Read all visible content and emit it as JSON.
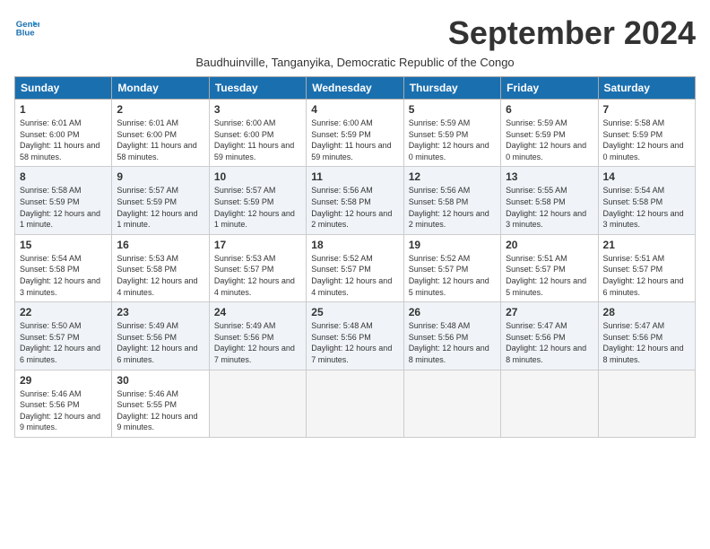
{
  "header": {
    "logo_line1": "General",
    "logo_line2": "Blue",
    "title": "September 2024",
    "subtitle": "Baudhuinville, Tanganyika, Democratic Republic of the Congo"
  },
  "days_of_week": [
    "Sunday",
    "Monday",
    "Tuesday",
    "Wednesday",
    "Thursday",
    "Friday",
    "Saturday"
  ],
  "weeks": [
    [
      {
        "day": "1",
        "rise": "6:01 AM",
        "set": "6:00 PM",
        "daylight": "11 hours and 58 minutes."
      },
      {
        "day": "2",
        "rise": "6:01 AM",
        "set": "6:00 PM",
        "daylight": "11 hours and 58 minutes."
      },
      {
        "day": "3",
        "rise": "6:00 AM",
        "set": "6:00 PM",
        "daylight": "11 hours and 59 minutes."
      },
      {
        "day": "4",
        "rise": "6:00 AM",
        "set": "5:59 PM",
        "daylight": "11 hours and 59 minutes."
      },
      {
        "day": "5",
        "rise": "5:59 AM",
        "set": "5:59 PM",
        "daylight": "12 hours and 0 minutes."
      },
      {
        "day": "6",
        "rise": "5:59 AM",
        "set": "5:59 PM",
        "daylight": "12 hours and 0 minutes."
      },
      {
        "day": "7",
        "rise": "5:58 AM",
        "set": "5:59 PM",
        "daylight": "12 hours and 0 minutes."
      }
    ],
    [
      {
        "day": "8",
        "rise": "5:58 AM",
        "set": "5:59 PM",
        "daylight": "12 hours and 1 minute."
      },
      {
        "day": "9",
        "rise": "5:57 AM",
        "set": "5:59 PM",
        "daylight": "12 hours and 1 minute."
      },
      {
        "day": "10",
        "rise": "5:57 AM",
        "set": "5:59 PM",
        "daylight": "12 hours and 1 minute."
      },
      {
        "day": "11",
        "rise": "5:56 AM",
        "set": "5:58 PM",
        "daylight": "12 hours and 2 minutes."
      },
      {
        "day": "12",
        "rise": "5:56 AM",
        "set": "5:58 PM",
        "daylight": "12 hours and 2 minutes."
      },
      {
        "day": "13",
        "rise": "5:55 AM",
        "set": "5:58 PM",
        "daylight": "12 hours and 3 minutes."
      },
      {
        "day": "14",
        "rise": "5:54 AM",
        "set": "5:58 PM",
        "daylight": "12 hours and 3 minutes."
      }
    ],
    [
      {
        "day": "15",
        "rise": "5:54 AM",
        "set": "5:58 PM",
        "daylight": "12 hours and 3 minutes."
      },
      {
        "day": "16",
        "rise": "5:53 AM",
        "set": "5:58 PM",
        "daylight": "12 hours and 4 minutes."
      },
      {
        "day": "17",
        "rise": "5:53 AM",
        "set": "5:57 PM",
        "daylight": "12 hours and 4 minutes."
      },
      {
        "day": "18",
        "rise": "5:52 AM",
        "set": "5:57 PM",
        "daylight": "12 hours and 4 minutes."
      },
      {
        "day": "19",
        "rise": "5:52 AM",
        "set": "5:57 PM",
        "daylight": "12 hours and 5 minutes."
      },
      {
        "day": "20",
        "rise": "5:51 AM",
        "set": "5:57 PM",
        "daylight": "12 hours and 5 minutes."
      },
      {
        "day": "21",
        "rise": "5:51 AM",
        "set": "5:57 PM",
        "daylight": "12 hours and 6 minutes."
      }
    ],
    [
      {
        "day": "22",
        "rise": "5:50 AM",
        "set": "5:57 PM",
        "daylight": "12 hours and 6 minutes."
      },
      {
        "day": "23",
        "rise": "5:49 AM",
        "set": "5:56 PM",
        "daylight": "12 hours and 6 minutes."
      },
      {
        "day": "24",
        "rise": "5:49 AM",
        "set": "5:56 PM",
        "daylight": "12 hours and 7 minutes."
      },
      {
        "day": "25",
        "rise": "5:48 AM",
        "set": "5:56 PM",
        "daylight": "12 hours and 7 minutes."
      },
      {
        "day": "26",
        "rise": "5:48 AM",
        "set": "5:56 PM",
        "daylight": "12 hours and 8 minutes."
      },
      {
        "day": "27",
        "rise": "5:47 AM",
        "set": "5:56 PM",
        "daylight": "12 hours and 8 minutes."
      },
      {
        "day": "28",
        "rise": "5:47 AM",
        "set": "5:56 PM",
        "daylight": "12 hours and 8 minutes."
      }
    ],
    [
      {
        "day": "29",
        "rise": "5:46 AM",
        "set": "5:56 PM",
        "daylight": "12 hours and 9 minutes."
      },
      {
        "day": "30",
        "rise": "5:46 AM",
        "set": "5:55 PM",
        "daylight": "12 hours and 9 minutes."
      },
      null,
      null,
      null,
      null,
      null
    ]
  ],
  "labels": {
    "sunrise": "Sunrise:",
    "sunset": "Sunset:",
    "daylight": "Daylight:"
  }
}
